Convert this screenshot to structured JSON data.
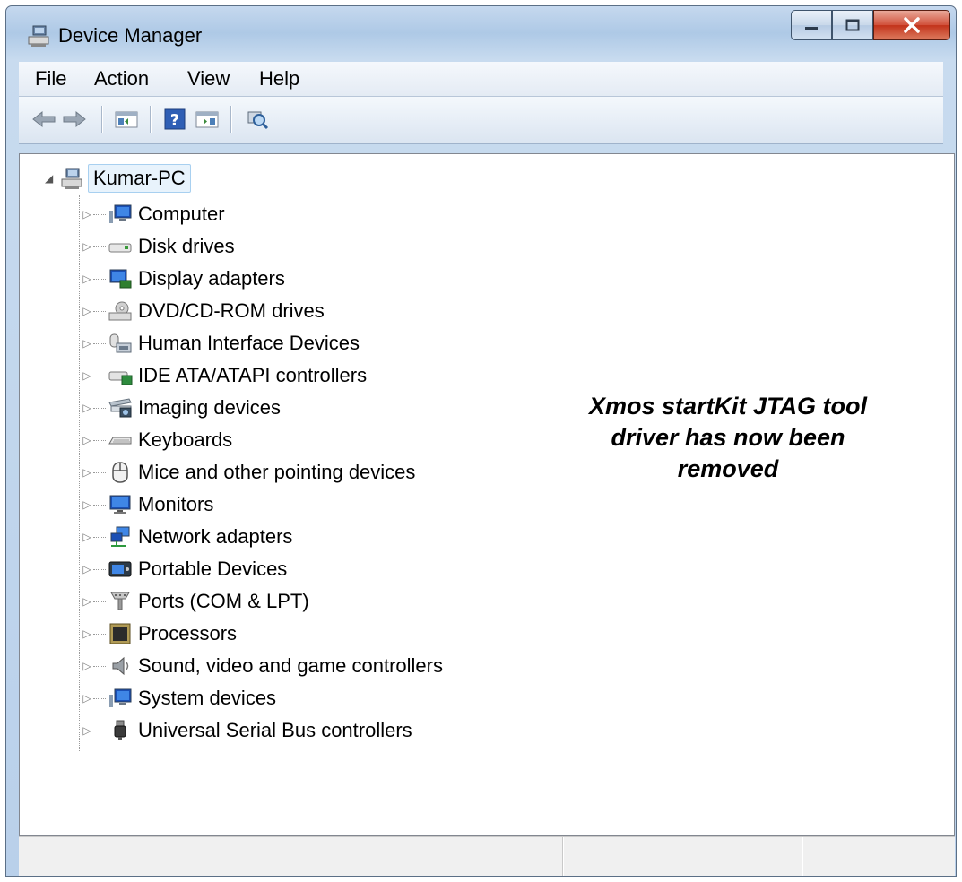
{
  "window": {
    "title": "Device Manager"
  },
  "colors": {
    "selection_border": "#a8d0f0",
    "selection_bg": "#e8f3fc",
    "close_button": "#c2321a"
  },
  "menu": [
    {
      "label": "File"
    },
    {
      "label": "Action"
    },
    {
      "label": "View"
    },
    {
      "label": "Help"
    }
  ],
  "toolbar": [
    {
      "icon": "back-arrow-icon"
    },
    {
      "icon": "forward-arrow-icon"
    },
    {
      "icon": "show-hide-console-tree-icon"
    },
    {
      "icon": "help-icon"
    },
    {
      "icon": "show-hide-action-pane-icon"
    },
    {
      "icon": "scan-hardware-changes-icon"
    }
  ],
  "tree": {
    "root": {
      "label": "Kumar-PC",
      "icon": "computer-network-icon",
      "expanded": true
    },
    "items": [
      {
        "label": "Computer",
        "icon": "computer-icon"
      },
      {
        "label": "Disk drives",
        "icon": "disk-drive-icon"
      },
      {
        "label": "Display adapters",
        "icon": "display-adapter-icon"
      },
      {
        "label": "DVD/CD-ROM drives",
        "icon": "dvd-drive-icon"
      },
      {
        "label": "Human Interface Devices",
        "icon": "hid-icon"
      },
      {
        "label": "IDE ATA/ATAPI controllers",
        "icon": "ide-controller-icon"
      },
      {
        "label": "Imaging devices",
        "icon": "imaging-device-icon"
      },
      {
        "label": "Keyboards",
        "icon": "keyboard-icon"
      },
      {
        "label": "Mice and other pointing devices",
        "icon": "mouse-icon"
      },
      {
        "label": "Monitors",
        "icon": "monitor-icon"
      },
      {
        "label": "Network adapters",
        "icon": "network-adapter-icon"
      },
      {
        "label": "Portable Devices",
        "icon": "portable-device-icon"
      },
      {
        "label": "Ports (COM & LPT)",
        "icon": "port-icon"
      },
      {
        "label": "Processors",
        "icon": "processor-icon"
      },
      {
        "label": "Sound, video and game controllers",
        "icon": "speaker-icon"
      },
      {
        "label": "System devices",
        "icon": "system-device-icon"
      },
      {
        "label": "Universal Serial Bus controllers",
        "icon": "usb-icon"
      }
    ]
  },
  "annotation": {
    "lines": [
      "Xmos startKit JTAG tool",
      "driver has now been",
      "removed"
    ]
  }
}
